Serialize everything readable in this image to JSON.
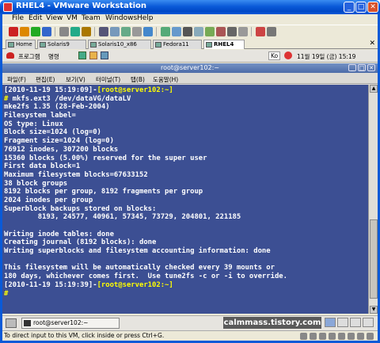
{
  "window": {
    "title": "RHEL4 - VMware Workstation"
  },
  "menu": [
    "File",
    "Edit",
    "View",
    "VM",
    "Team",
    "Windows",
    "Help"
  ],
  "vm_tabs": [
    {
      "label": "Home",
      "active": false
    },
    {
      "label": "Solaris9",
      "active": false
    },
    {
      "label": "Solaris10_x86",
      "active": false
    },
    {
      "label": "Fedora11",
      "active": false
    },
    {
      "label": "RHEL4",
      "active": true
    }
  ],
  "guest_panel": {
    "applications": "프로그램",
    "places": "명령",
    "ime_indicator": "Ko",
    "clock": "11월 19일 (금)  15:19"
  },
  "terminal": {
    "title": "root@server102:~",
    "menu": [
      "파일(F)",
      "편집(E)",
      "보기(V)",
      "터미널(T)",
      "탭(B)",
      "도움말(H)"
    ],
    "lines": [
      {
        "pre": "[2010-11-19 15:19:09]-",
        "hl": "[root@server102:~]",
        "post": ""
      },
      {
        "pre": "",
        "hl": "#",
        "post": " mkfs.ext3 /dev/dataVG/dataLV"
      },
      {
        "pre": "mke2fs 1.35 (28-Feb-2004)",
        "hl": "",
        "post": ""
      },
      {
        "pre": "Filesystem label=",
        "hl": "",
        "post": ""
      },
      {
        "pre": "OS type: Linux",
        "hl": "",
        "post": ""
      },
      {
        "pre": "Block size=1024 (log=0)",
        "hl": "",
        "post": ""
      },
      {
        "pre": "Fragment size=1024 (log=0)",
        "hl": "",
        "post": ""
      },
      {
        "pre": "76912 inodes, 307200 blocks",
        "hl": "",
        "post": ""
      },
      {
        "pre": "15360 blocks (5.00%) reserved for the super user",
        "hl": "",
        "post": ""
      },
      {
        "pre": "First data block=1",
        "hl": "",
        "post": ""
      },
      {
        "pre": "Maximum filesystem blocks=67633152",
        "hl": "",
        "post": ""
      },
      {
        "pre": "38 block groups",
        "hl": "",
        "post": ""
      },
      {
        "pre": "8192 blocks per group, 8192 fragments per group",
        "hl": "",
        "post": ""
      },
      {
        "pre": "2024 inodes per group",
        "hl": "",
        "post": ""
      },
      {
        "pre": "Superblock backups stored on blocks:",
        "hl": "",
        "post": ""
      },
      {
        "pre": "        8193, 24577, 40961, 57345, 73729, 204801, 221185",
        "hl": "",
        "post": ""
      },
      {
        "pre": "",
        "hl": "",
        "post": ""
      },
      {
        "pre": "Writing inode tables: done",
        "hl": "",
        "post": ""
      },
      {
        "pre": "Creating journal (8192 blocks): done",
        "hl": "",
        "post": ""
      },
      {
        "pre": "Writing superblocks and filesystem accounting information: done",
        "hl": "",
        "post": ""
      },
      {
        "pre": "",
        "hl": "",
        "post": ""
      },
      {
        "pre": "This filesystem will be automatically checked every 39 mounts or",
        "hl": "",
        "post": ""
      },
      {
        "pre": "180 days, whichever comes first.  Use tune2fs -c or -i to override.",
        "hl": "",
        "post": ""
      },
      {
        "pre": "[2010-11-19 15:19:39]-",
        "hl": "[root@server102:~]",
        "post": ""
      },
      {
        "pre": "",
        "hl": "#",
        "post": ""
      }
    ]
  },
  "taskbar": {
    "task_label": "root@server102:~",
    "watermark": "calmmass.tistory.com"
  },
  "status": {
    "hint": "To direct input to this VM, click inside or press Ctrl+G."
  },
  "colors": {
    "terminal_bg": "#3c4f93",
    "terminal_fg": "#ffffff",
    "prompt_highlight": "#ffff00"
  }
}
